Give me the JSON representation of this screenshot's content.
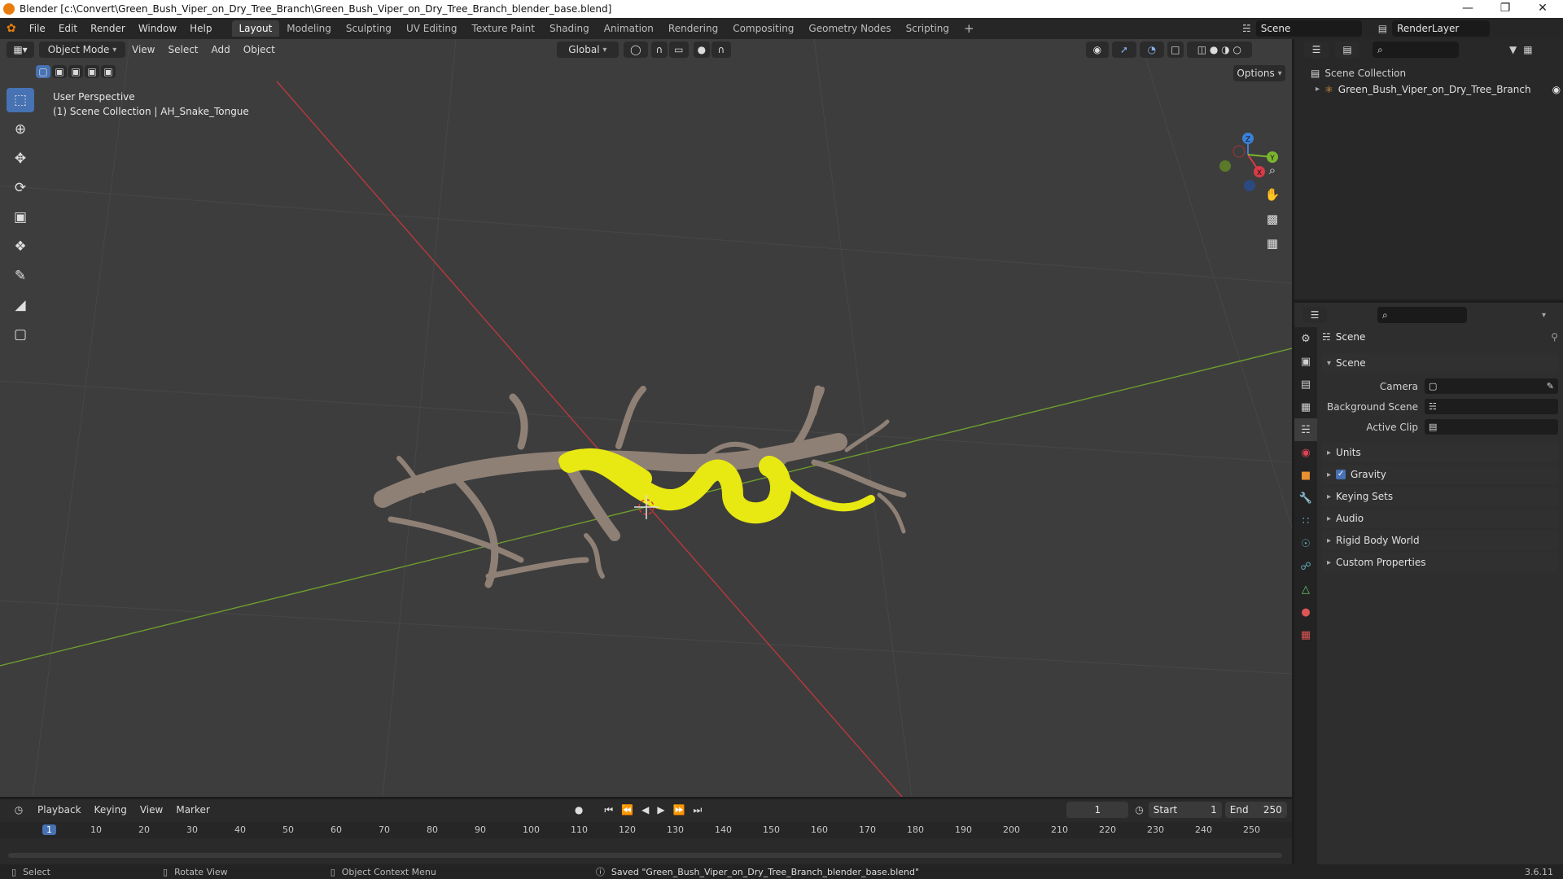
{
  "title_bar": {
    "text": "Blender [c:\\Convert\\Green_Bush_Viper_on_Dry_Tree_Branch\\Green_Bush_Viper_on_Dry_Tree_Branch_blender_base.blend]"
  },
  "menu": [
    "File",
    "Edit",
    "Render",
    "Window",
    "Help"
  ],
  "workspaces": [
    "Layout",
    "Modeling",
    "Sculpting",
    "UV Editing",
    "Texture Paint",
    "Shading",
    "Animation",
    "Rendering",
    "Compositing",
    "Geometry Nodes",
    "Scripting"
  ],
  "active_workspace": "Layout",
  "scene_name": "Scene",
  "render_layer": "RenderLayer",
  "viewport": {
    "mode": "Object Mode",
    "menus": [
      "View",
      "Select",
      "Add",
      "Object"
    ],
    "transform_orientation": "Global",
    "options_label": "Options",
    "overlay_title": "User Perspective",
    "overlay_subtitle": "(1) Scene Collection | AH_Snake_Tongue",
    "gizmo_labels": {
      "x": "X",
      "y": "Y",
      "z": "Z"
    }
  },
  "outliner": {
    "root": "Scene Collection",
    "items": [
      "Green_Bush_Viper_on_Dry_Tree_Branch"
    ]
  },
  "properties": {
    "header": "Scene",
    "panel_title": "Scene",
    "fields": [
      {
        "label": "Camera",
        "value": ""
      },
      {
        "label": "Background Scene",
        "value": ""
      },
      {
        "label": "Active Clip",
        "value": ""
      }
    ],
    "sections": [
      "Units",
      "Gravity",
      "Keying Sets",
      "Audio",
      "Rigid Body World",
      "Custom Properties"
    ],
    "gravity_checked": true
  },
  "timeline": {
    "menus": [
      "Playback",
      "Keying",
      "View",
      "Marker"
    ],
    "current_frame": "1",
    "start_label": "Start",
    "start": "1",
    "end_label": "End",
    "end": "250",
    "ruler": [
      "1",
      "10",
      "20",
      "30",
      "40",
      "50",
      "60",
      "70",
      "80",
      "90",
      "100",
      "110",
      "120",
      "130",
      "140",
      "150",
      "160",
      "170",
      "180",
      "190",
      "200",
      "210",
      "220",
      "230",
      "240",
      "250"
    ]
  },
  "status_bar": {
    "select": "Select",
    "rotate": "Rotate View",
    "context": "Object Context Menu",
    "message": "Saved \"Green_Bush_Viper_on_Dry_Tree_Branch_blender_base.blend\"",
    "version": "3.6.11"
  },
  "colors": {
    "accent": "#4772b3",
    "snake": "#e8e812",
    "branch": "#9a8a7c",
    "axis_x": "#c0393f",
    "axis_y": "#6a9a2a"
  }
}
